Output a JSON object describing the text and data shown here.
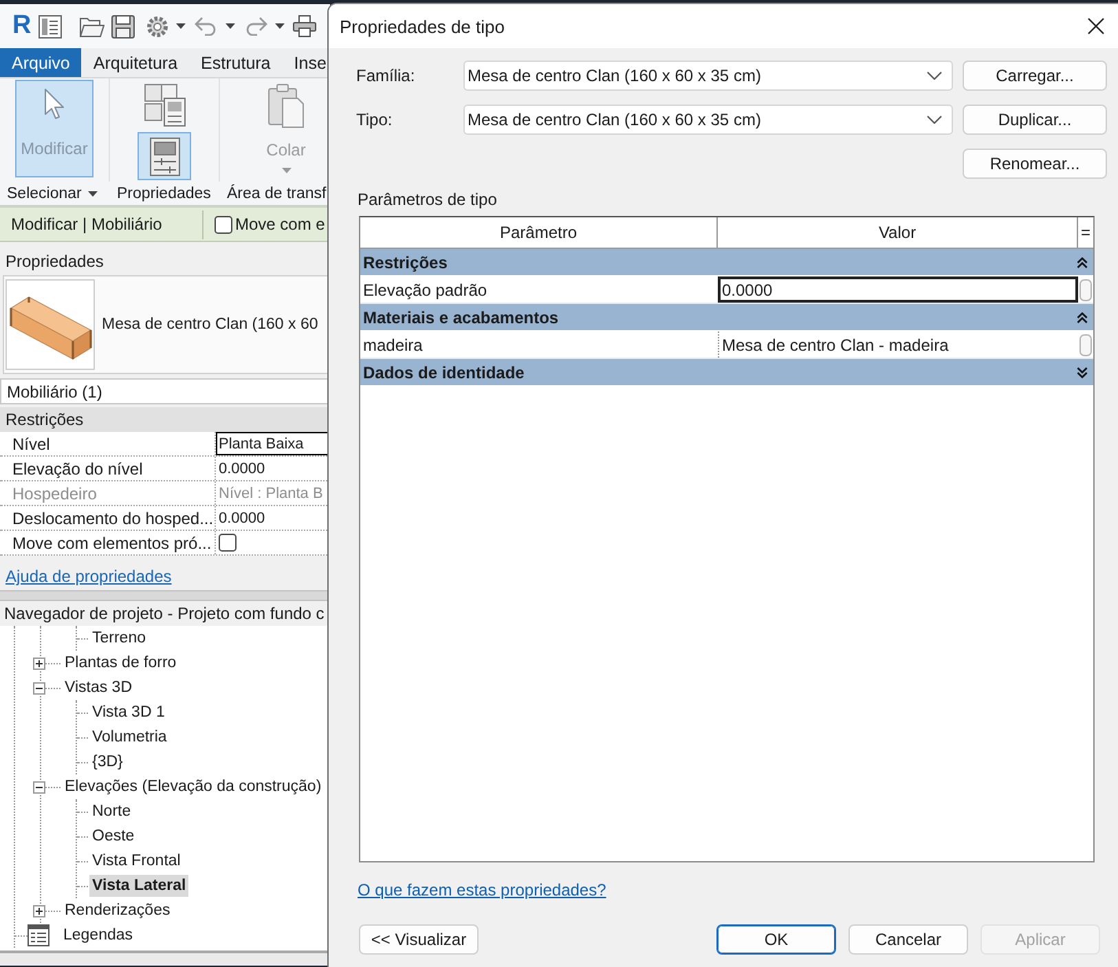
{
  "app": {
    "logo": "R",
    "ribbon": {
      "file_tab": "Arquivo",
      "tabs": [
        {
          "label": "Arquitetura",
          "selected": false
        },
        {
          "label": "Estrutura",
          "selected": false
        },
        {
          "label": "Inse",
          "selected": false
        }
      ],
      "panels": [
        {
          "title": "Selecionar",
          "dropdown": true,
          "tools": [
            {
              "kind": "modify",
              "label": "Modificar",
              "selected": true
            }
          ]
        },
        {
          "title": "Propriedades",
          "dropdown": false,
          "tools": [
            {
              "kind": "type-properties",
              "selected": false
            },
            {
              "kind": "properties",
              "selected": true
            }
          ]
        },
        {
          "title": "Área de transf",
          "dropdown": false,
          "tools": [
            {
              "kind": "paste",
              "label": "Colar",
              "selected": false,
              "disabled": true,
              "dropdown": true
            }
          ]
        }
      ]
    },
    "context_bar": {
      "title": "Modificar | Mobiliário",
      "option": {
        "label": "Move com e",
        "checked": false
      }
    },
    "properties": {
      "title": "Propriedades",
      "type_name": "Mesa de centro Clan (160 x 60",
      "filter": "Mobiliário (1)",
      "groups": [
        {
          "label": "Restrições",
          "rows": [
            {
              "kind": "text",
              "name": "Nível",
              "value": "Planta Baixa",
              "selected": true,
              "disabled": false
            },
            {
              "kind": "text",
              "name": "Elevação do nível",
              "value": "0.0000",
              "selected": false,
              "disabled": false
            },
            {
              "kind": "text",
              "name": "Hospedeiro",
              "value": "Nível : Planta B",
              "selected": false,
              "disabled": true
            },
            {
              "kind": "text",
              "name": "Deslocamento do hosped...",
              "value": "0.0000",
              "selected": false,
              "disabled": false
            },
            {
              "kind": "checkbox",
              "name": "Move com elementos pró...",
              "checked": false,
              "selected": false,
              "disabled": false
            }
          ]
        }
      ],
      "help_link": "Ajuda de propriedades"
    },
    "project_browser": {
      "title": "Navegador de projeto - Projeto com fundo c",
      "items": [
        {
          "children": [
            {
              "children": [
                {
                  "label": "Terreno",
                  "selected": false
                }
              ]
            },
            {
              "label": "Plantas de forro",
              "expanded": false,
              "selected": false
            },
            {
              "label": "Vistas 3D",
              "expanded": true,
              "selected": false,
              "children": [
                {
                  "label": "Vista 3D 1",
                  "selected": false
                },
                {
                  "label": "Volumetria",
                  "selected": false
                },
                {
                  "label": "{3D}",
                  "selected": false
                }
              ]
            },
            {
              "label": "Elevações (Elevação da construção)",
              "expanded": true,
              "selected": false,
              "children": [
                {
                  "label": "Norte",
                  "selected": false
                },
                {
                  "label": "Oeste",
                  "selected": false
                },
                {
                  "label": "Vista Frontal",
                  "selected": false
                },
                {
                  "label": "Vista Lateral",
                  "selected": true
                }
              ]
            },
            {
              "label": "Renderizações",
              "expanded": false,
              "selected": false
            }
          ]
        },
        {
          "label": "Legendas",
          "selected": false
        }
      ]
    }
  },
  "dialog": {
    "title": "Propriedades de tipo",
    "fields": [
      {
        "label": "Família:",
        "value": "Mesa de centro Clan (160 x 60 x 35 cm)"
      },
      {
        "label": "Tipo:",
        "value": "Mesa de centro Clan (160 x 60 x 35 cm)"
      }
    ],
    "side_buttons": [
      "Carregar...",
      "Duplicar...",
      "Renomear..."
    ],
    "parameters": {
      "label": "Parâmetros de tipo",
      "columns": [
        "Parâmetro",
        "Valor",
        "="
      ],
      "groups": [
        {
          "label": "Restrições",
          "expanded": true,
          "rows": [
            {
              "name": "Elevação padrão",
              "value": "0.0000",
              "selected": true
            }
          ]
        },
        {
          "label": "Materiais e acabamentos",
          "expanded": true,
          "rows": [
            {
              "name": "madeira",
              "value": "Mesa de centro Clan - madeira",
              "selected": false
            }
          ]
        },
        {
          "label": "Dados de identidade",
          "expanded": false
        }
      ]
    },
    "help_link": "O que fazem estas propriedades?",
    "preview_button": "<< Visualizar",
    "buttons": [
      {
        "label": "OK",
        "default": true,
        "disabled": false
      },
      {
        "label": "Cancelar",
        "default": false,
        "disabled": false
      },
      {
        "label": "Aplicar",
        "default": false,
        "disabled": true
      }
    ]
  }
}
